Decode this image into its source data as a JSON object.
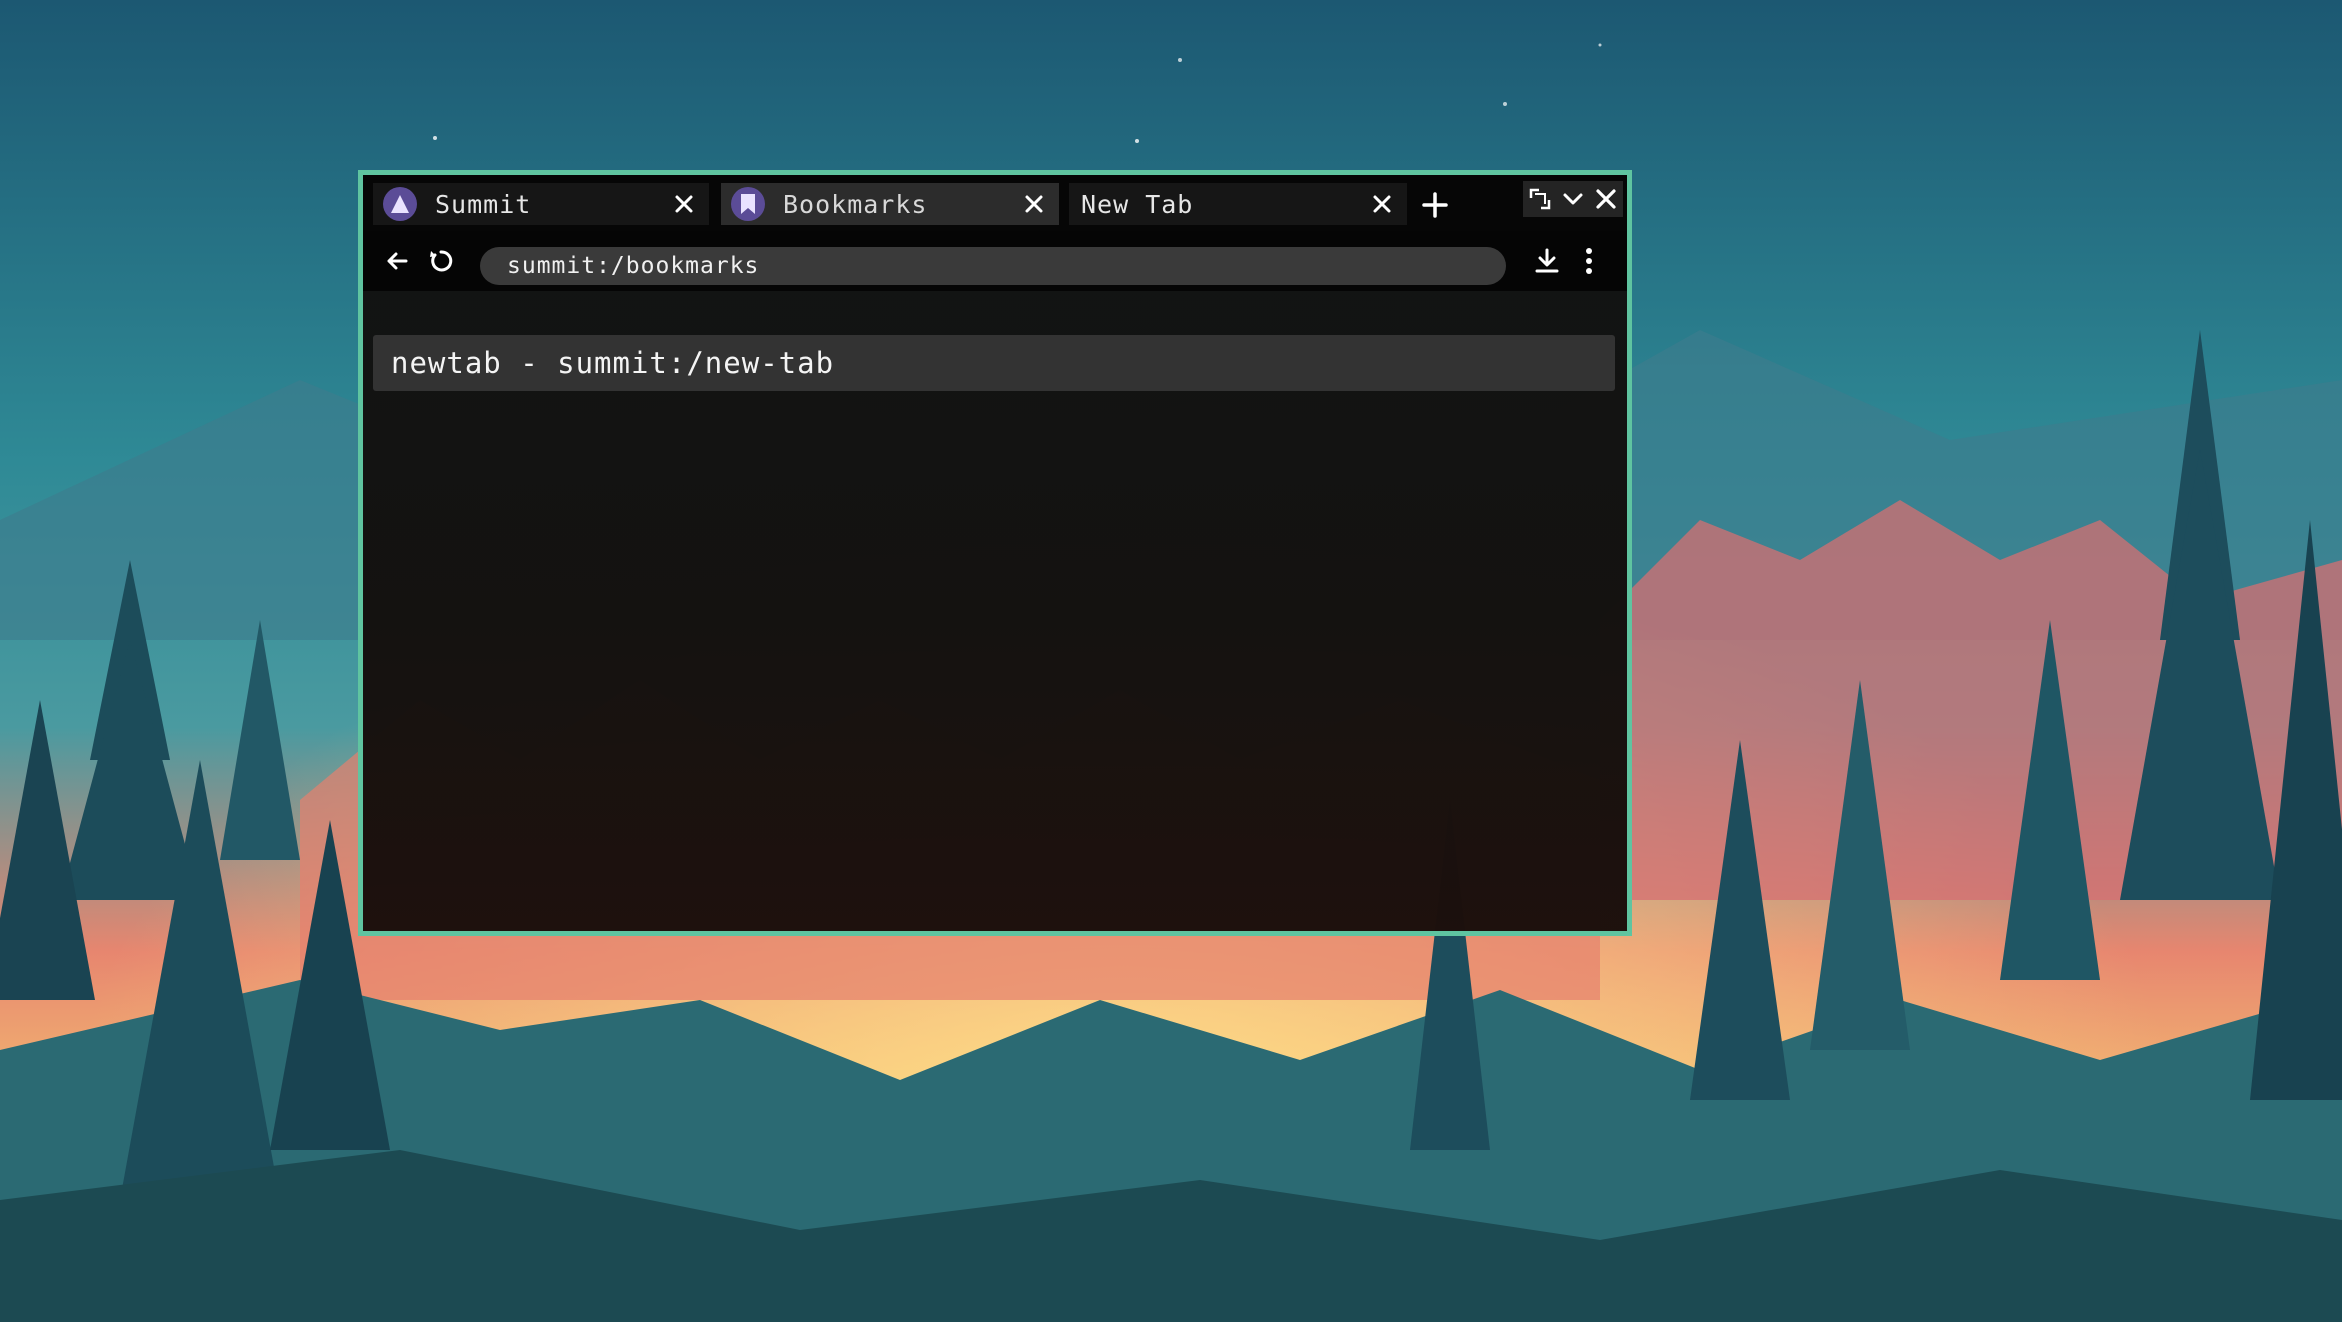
{
  "tabs": [
    {
      "title": "Summit",
      "icon": "summit-logo-icon",
      "active": false
    },
    {
      "title": "Bookmarks",
      "icon": "bookmark-icon",
      "active": true
    },
    {
      "title": "New Tab",
      "icon": "",
      "active": false
    }
  ],
  "navigation": {
    "address": "summit:/bookmarks"
  },
  "bookmarks": [
    {
      "label": "newtab - summit:/new-tab"
    }
  ],
  "colors": {
    "window_border": "#5fc4a0",
    "tab_icon_bg": "#5b4c97",
    "address_bg": "#3a3a3a"
  }
}
